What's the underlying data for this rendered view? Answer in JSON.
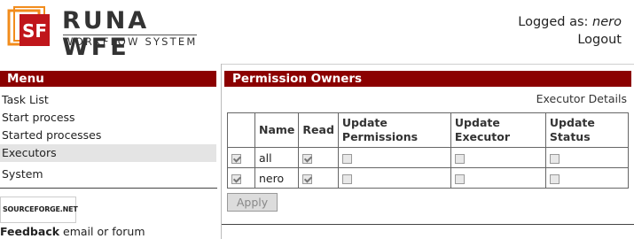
{
  "header": {
    "logo_mark": "SF",
    "logo_title": "RUNA WFE",
    "logo_subtitle": "WORKFLOW SYSTEM",
    "logged_as_label": "Logged as:",
    "user_name": "nero",
    "logout_label": "Logout"
  },
  "menu": {
    "title": "Menu",
    "items": [
      {
        "label": "Task List"
      },
      {
        "label": "Start process"
      },
      {
        "label": "Started processes"
      },
      {
        "label": "Executors",
        "active": true
      },
      {
        "label": "System"
      }
    ],
    "sourceforge_label": "SOURCEFORGE.NET",
    "feedback_bold": "Feedback",
    "feedback_rest": " email or forum"
  },
  "content": {
    "panel_title": "Permission Owners",
    "executor_details_link": "Executor Details",
    "table": {
      "columns": [
        "",
        "Name",
        "Read",
        "Update\nPermissions",
        "Update\nExecutor",
        "Update\nStatus"
      ],
      "columns_html": [
        "",
        "Name",
        "Read",
        "Update<br>Permissions",
        "Update<br>Executor",
        "Update<br>Status"
      ],
      "rows": [
        {
          "name": "all",
          "selected": true,
          "read": true,
          "update_permissions": false,
          "update_executor": false,
          "update_status": false
        },
        {
          "name": "nero",
          "selected": true,
          "read": true,
          "update_permissions": false,
          "update_executor": false,
          "update_status": false
        }
      ]
    },
    "apply_label": "Apply"
  },
  "colors": {
    "header_bar": "#8b0000",
    "logo_red": "#c0161b",
    "logo_orange": "#f28c1c"
  }
}
